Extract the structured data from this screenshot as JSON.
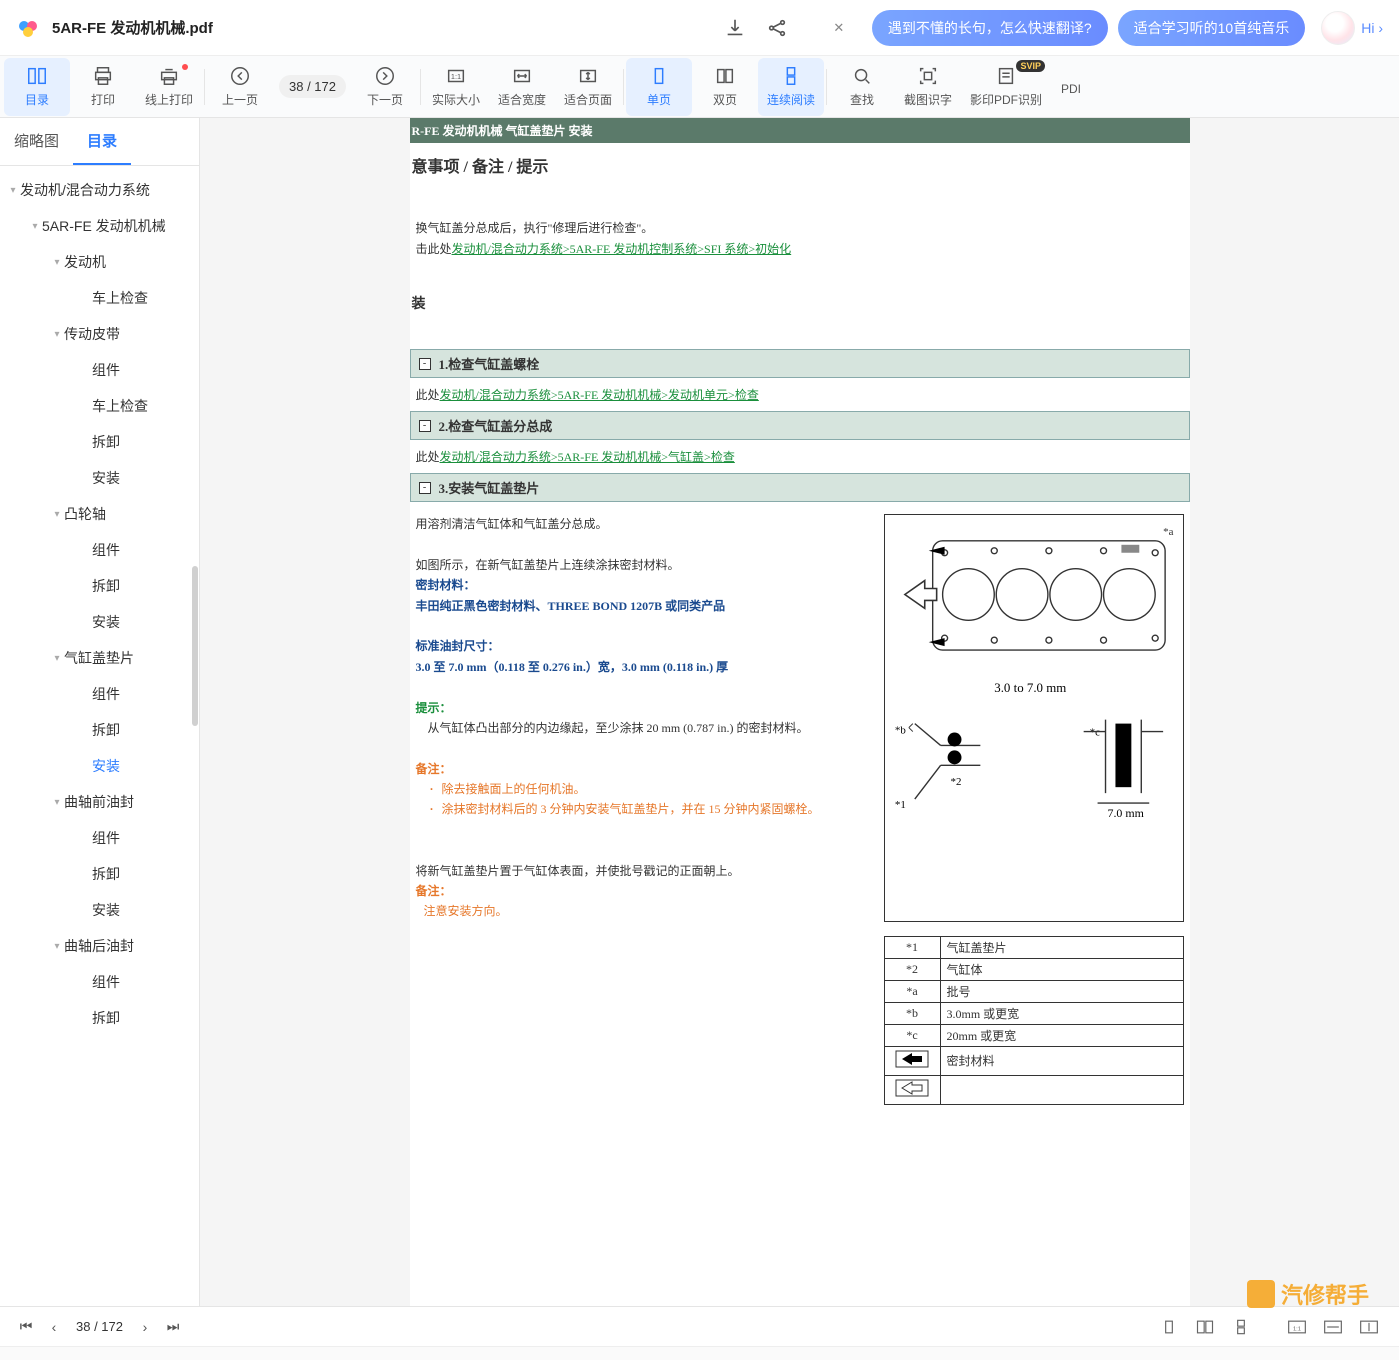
{
  "topbar": {
    "filename": "5AR-FE 发动机机械.pdf",
    "pill1": "遇到不懂的长句，怎么快速翻译?",
    "pill2": "适合学习听的10首纯音乐",
    "hi": "Hi ›"
  },
  "toolbar": {
    "catalog": "目录",
    "print": "打印",
    "online_print": "线上打印",
    "prev": "上一页",
    "page_indicator": "38  / 172",
    "next": "下一页",
    "actual": "实际大小",
    "fit_width": "适合宽度",
    "fit_page": "适合页面",
    "single": "单页",
    "double": "双页",
    "cont_read": "连续阅读",
    "find": "查找",
    "clip_ocr": "截图识字",
    "scan_pdf": "影印PDF识别",
    "pdf_more": "PDI"
  },
  "sidebar": {
    "tab_thumb": "缩略图",
    "tab_toc": "目录",
    "tree": [
      {
        "lv": 0,
        "caret": "▾",
        "label": "发动机/混合动力系统"
      },
      {
        "lv": 1,
        "caret": "▾",
        "label": "5AR-FE 发动机机械"
      },
      {
        "lv": 2,
        "caret": "▾",
        "label": "发动机"
      },
      {
        "lv": 3,
        "caret": "",
        "label": "车上检查"
      },
      {
        "lv": 2,
        "caret": "▾",
        "label": "传动皮带"
      },
      {
        "lv": 3,
        "caret": "",
        "label": "组件"
      },
      {
        "lv": 3,
        "caret": "",
        "label": "车上检查"
      },
      {
        "lv": 3,
        "caret": "",
        "label": "拆卸"
      },
      {
        "lv": 3,
        "caret": "",
        "label": "安装"
      },
      {
        "lv": 2,
        "caret": "▾",
        "label": "凸轮轴"
      },
      {
        "lv": 3,
        "caret": "",
        "label": "组件"
      },
      {
        "lv": 3,
        "caret": "",
        "label": "拆卸"
      },
      {
        "lv": 3,
        "caret": "",
        "label": "安装"
      },
      {
        "lv": 2,
        "caret": "▾",
        "label": "气缸盖垫片"
      },
      {
        "lv": 3,
        "caret": "",
        "label": "组件"
      },
      {
        "lv": 3,
        "caret": "",
        "label": "拆卸"
      },
      {
        "lv": 3,
        "caret": "",
        "label": "安装",
        "sel": true
      },
      {
        "lv": 2,
        "caret": "▾",
        "label": "曲轴前油封"
      },
      {
        "lv": 3,
        "caret": "",
        "label": "组件"
      },
      {
        "lv": 3,
        "caret": "",
        "label": "拆卸"
      },
      {
        "lv": 3,
        "caret": "",
        "label": "安装"
      },
      {
        "lv": 2,
        "caret": "▾",
        "label": "曲轴后油封"
      },
      {
        "lv": 3,
        "caret": "",
        "label": "组件"
      },
      {
        "lv": 3,
        "caret": "",
        "label": "拆卸"
      }
    ]
  },
  "doc": {
    "header_strip": "R-FE 发动机机械   气缸盖垫片   安装",
    "title": "意事项 / 备注 / 提示",
    "intro1": "换气缸盖分总成后，执行\"修理后进行检查\"。",
    "intro2_pre": "击此处",
    "intro2_link": "发动机/混合动力系统>5AR-FE 发动机控制系统>SFI 系统>初始化",
    "install_head": "装",
    "sec1_title": "1.检查气缸盖螺栓",
    "sec1_pre": "此处",
    "sec1_link": "发动机/混合动力系统>5AR-FE 发动机机械>发动机单元>检查",
    "sec2_title": "2.检查气缸盖分总成",
    "sec2_pre": "此处",
    "sec2_link": "发动机/混合动力系统>5AR-FE 发动机机械>气缸盖>检查",
    "sec3_title": "3.安装气缸盖垫片",
    "s3_p1": "用溶剂清洁气缸体和气缸盖分总成。",
    "s3_p2": "如图所示，在新气缸盖垫片上连续涂抹密封材料。",
    "s3_mat_label": "密封材料：",
    "s3_mat": "丰田纯正黑色密封材料、THREE BOND 1207B 或同类产品",
    "s3_size_label": "标准油封尺寸：",
    "s3_size": "3.0 至 7.0 mm（0.118 至 0.276 in.）宽，3.0 mm (0.118 in.) 厚",
    "s3_tip_label": "提示：",
    "s3_tip": "从气缸体凸出部分的内边缘起，至少涂抹 20 mm (0.787 in.) 的密封材料。",
    "s3_note_label": "备注：",
    "s3_note1": "除去接触面上的任何机油。",
    "s3_note2": "涂抹密封材料后的 3 分钟内安装气缸盖垫片，并在 15 分钟内紧固螺栓。",
    "s3_p3": "将新气缸盖垫片置于气缸体表面，并使批号戳记的正面朝上。",
    "s3_note2_label": "备注：",
    "s3_note2_txt": "注意安装方向。",
    "diag_30_70": "3.0 to 7.0 mm",
    "diag_70": "7.0 mm",
    "legend": [
      {
        "k": "*1",
        "v": "气缸盖垫片"
      },
      {
        "k": "*2",
        "v": "气缸体"
      },
      {
        "k": "*a",
        "v": "批号"
      },
      {
        "k": "*b",
        "v": "3.0mm 或更宽"
      },
      {
        "k": "*c",
        "v": "20mm 或更宽"
      }
    ],
    "legend_arrow_solid": "密封材料",
    "legend_arrow_hollow": ""
  },
  "bottombar": {
    "page": "38  / 172"
  },
  "watermark": "汽修帮手"
}
